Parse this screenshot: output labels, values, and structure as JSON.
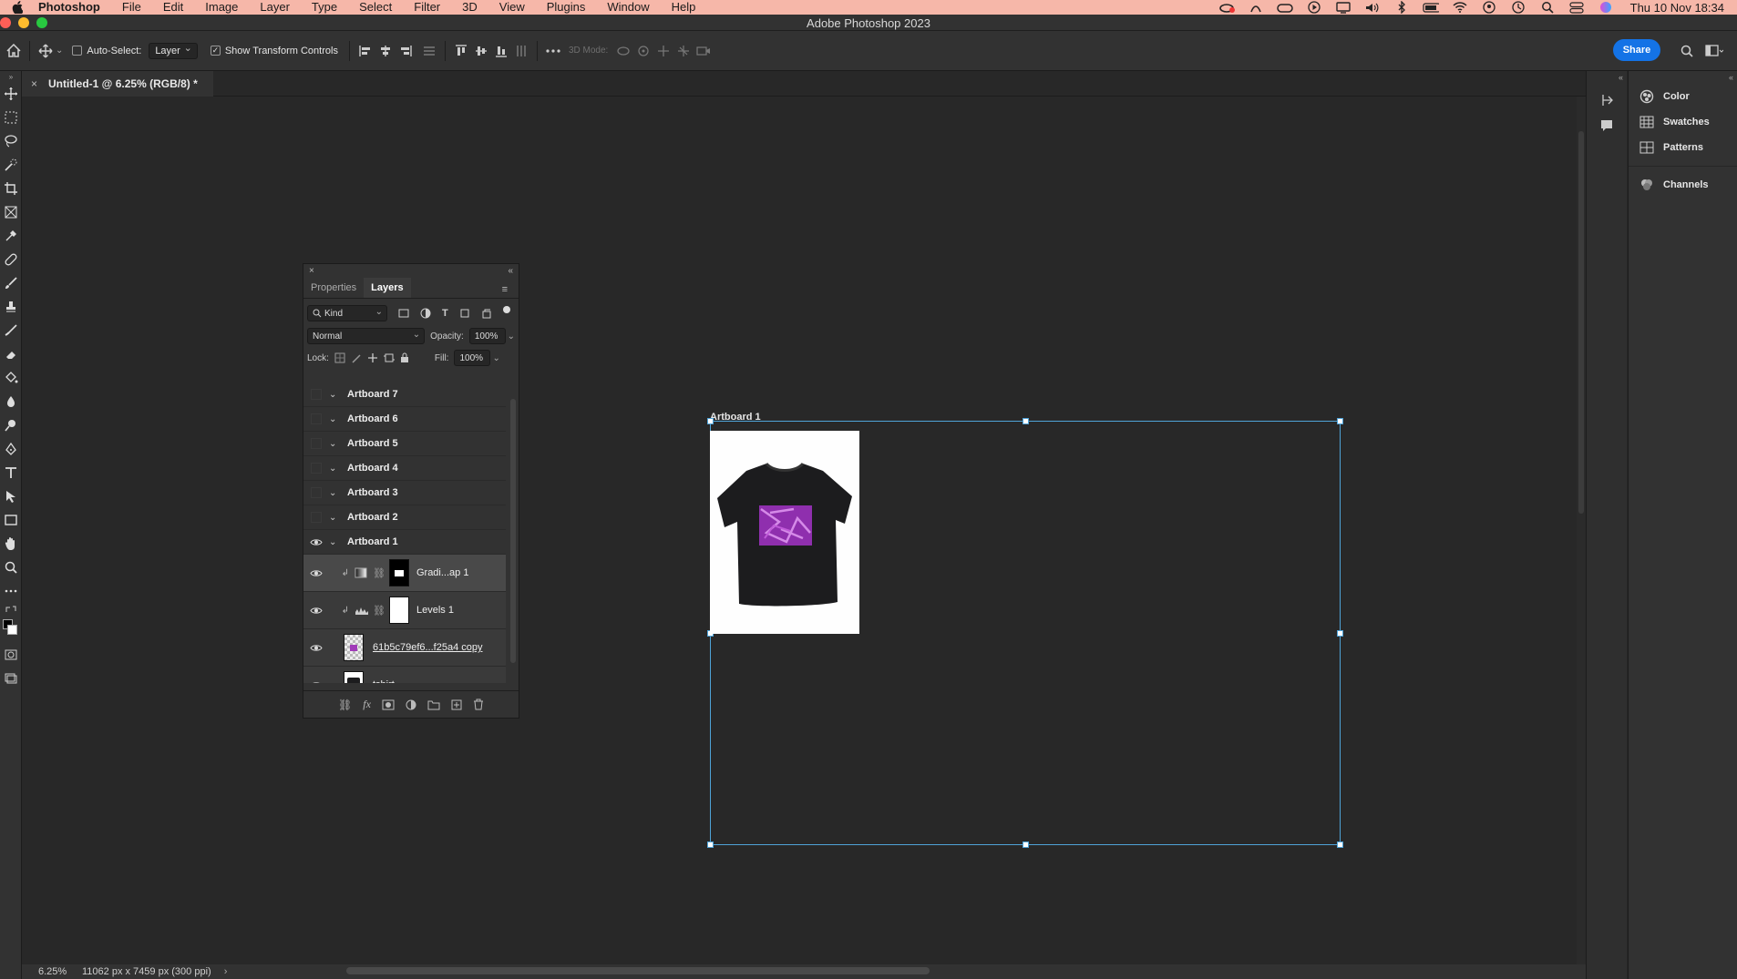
{
  "menubar": {
    "app": "Photoshop",
    "items": [
      "File",
      "Edit",
      "Image",
      "Layer",
      "Type",
      "Select",
      "Filter",
      "3D",
      "View",
      "Plugins",
      "Window",
      "Help"
    ],
    "clock": "Thu 10 Nov  18:34",
    "bg_color": "#f6b7a9"
  },
  "titlebar": {
    "title": "Adobe Photoshop 2023"
  },
  "options": {
    "auto_select_label": "Auto-Select:",
    "auto_select_checked": false,
    "auto_select_target": "Layer",
    "transform_label": "Show Transform Controls",
    "transform_checked": true,
    "mode_3d_label": "3D Mode:",
    "share_label": "Share",
    "share_color": "#1473e6"
  },
  "document": {
    "tab_label": "Untitled-1 @ 6.25% (RGB/8) *",
    "artboard_label": "Artboard 1",
    "zoom": "6.25%",
    "doc_info": "11062 px x 7459 px (300 ppi)"
  },
  "right_panel": {
    "items": [
      {
        "label": "Color",
        "icon": "color-wheel-icon"
      },
      {
        "label": "Swatches",
        "icon": "grid-icon"
      },
      {
        "label": "Patterns",
        "icon": "grid-icon"
      },
      {
        "label": "Channels",
        "icon": "channels-icon"
      }
    ]
  },
  "layers_panel": {
    "tabs": [
      "Properties",
      "Layers"
    ],
    "active_tab": "Layers",
    "filter_kind": "Kind",
    "blend_mode": "Normal",
    "opacity_label": "Opacity:",
    "opacity_value": "100%",
    "lock_label": "Lock:",
    "fill_label": "Fill:",
    "fill_value": "100%",
    "artboards": [
      "Artboard 7",
      "Artboard 6",
      "Artboard 5",
      "Artboard 4",
      "Artboard 3",
      "Artboard 2",
      "Artboard 1"
    ],
    "sublayers": [
      {
        "name": "Gradi...ap 1",
        "type": "gradient-map"
      },
      {
        "name": "Levels 1",
        "type": "levels"
      },
      {
        "name": "61b5c79ef6...f25a4 copy",
        "type": "smart-object"
      },
      {
        "name": "tshirt",
        "type": "image"
      }
    ]
  }
}
